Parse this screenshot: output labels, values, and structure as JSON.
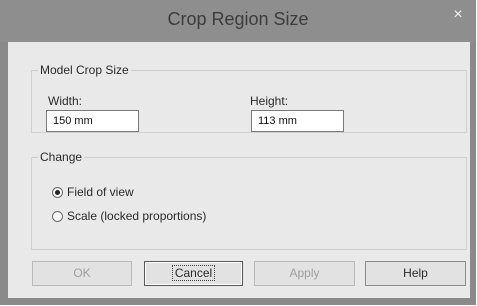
{
  "window": {
    "title": "Crop Region Size",
    "close_glyph": "×"
  },
  "model_crop": {
    "legend": "Model Crop Size",
    "width_label": "Width:",
    "width_value": "150 mm",
    "height_label": "Height:",
    "height_value": "113 mm"
  },
  "change": {
    "legend": "Change",
    "options": [
      {
        "label": "Field of view",
        "checked": true
      },
      {
        "label": "Scale (locked proportions)",
        "checked": false
      }
    ]
  },
  "buttons": {
    "ok": "OK",
    "cancel": "Cancel",
    "apply": "Apply",
    "help": "Help"
  }
}
